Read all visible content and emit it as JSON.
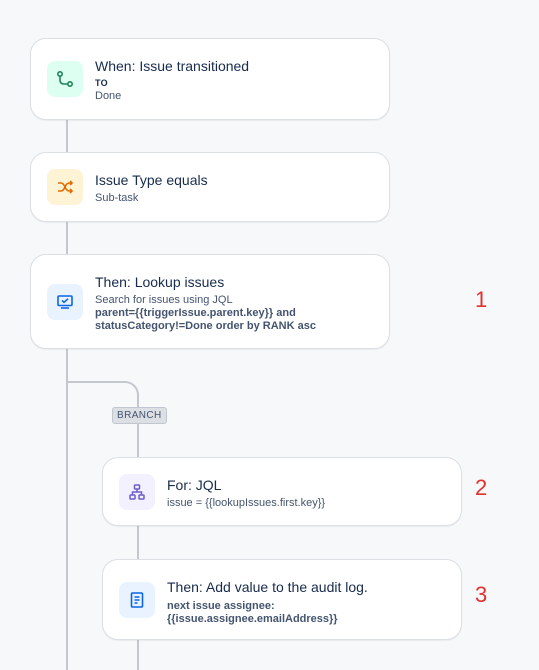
{
  "flow": {
    "trigger": {
      "icon": "transition-icon",
      "title": "When: Issue transitioned",
      "label": "TO",
      "value": "Done"
    },
    "condition": {
      "icon": "shuffle-icon",
      "title": "Issue Type equals",
      "value": "Sub-task"
    },
    "lookup": {
      "icon": "lookup-screen-icon",
      "title": "Then: Lookup issues",
      "description": "Search for issues using JQL",
      "jql_line1": "parent={{triggerIssue.parent.key}} and",
      "jql_line2": "statusCategory!=Done order by RANK asc"
    },
    "branch_label": "BRANCH",
    "for_jql": {
      "icon": "hierarchy-icon",
      "title": "For: JQL",
      "value": "issue = {{lookupIssues.first.key}}"
    },
    "audit": {
      "icon": "document-icon",
      "title": "Then: Add value to the audit log.",
      "line1": "next issue assignee:",
      "line2": "{{issue.assignee.emailAddress}}"
    }
  },
  "markers": [
    "1",
    "2",
    "3"
  ],
  "colors": {
    "trigger_icon_bg": "#dcfff1",
    "trigger_icon_fg": "#1f845a",
    "condition_icon_bg": "#fff3d6",
    "condition_icon_fg": "#e06c00",
    "action_icon_bg": "#e9f2ff",
    "action_icon_fg": "#0c66e4",
    "branch_icon_bg": "#f3f0ff",
    "branch_icon_fg": "#6e5dc6",
    "marker": "#e03131"
  }
}
